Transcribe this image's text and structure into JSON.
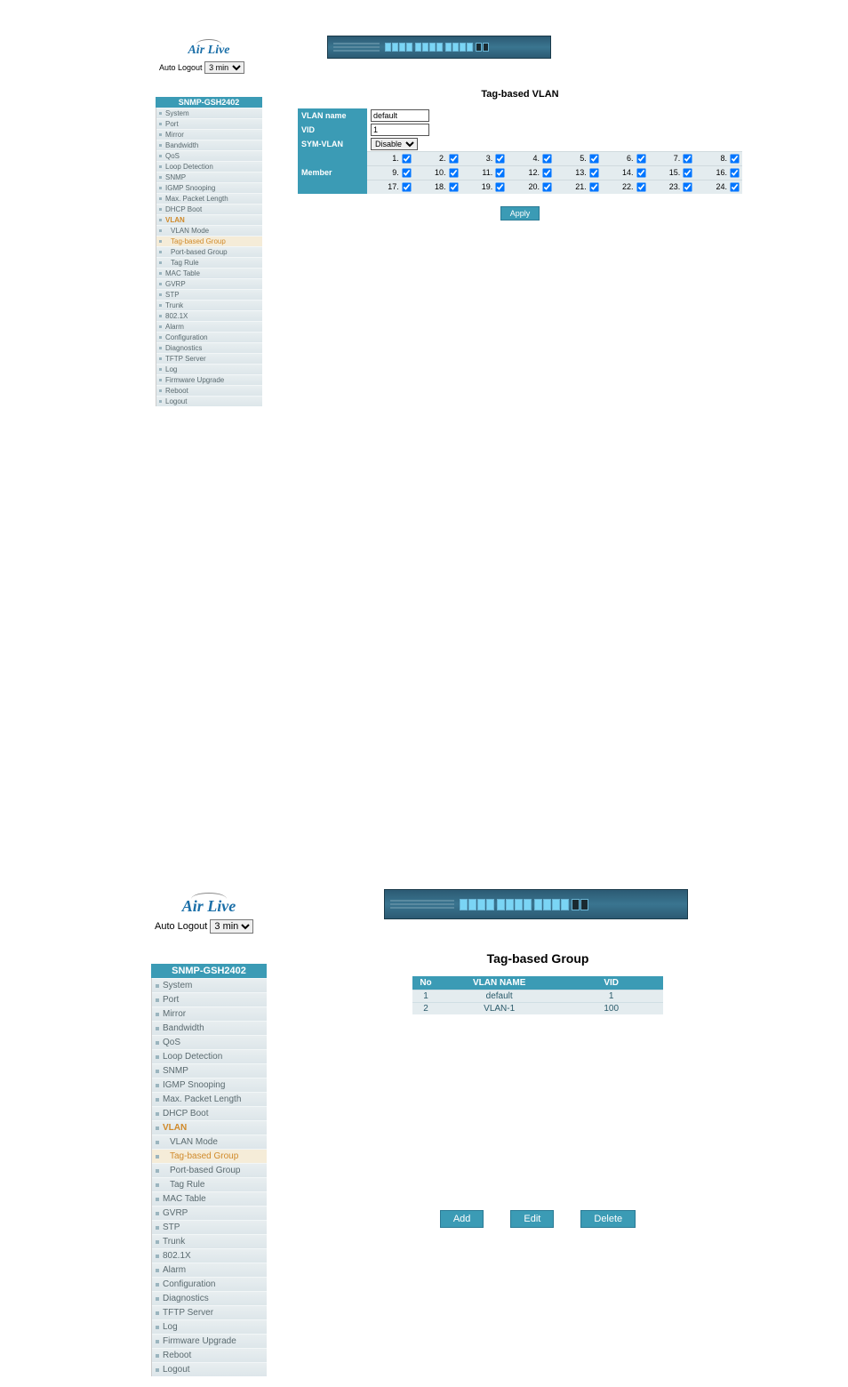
{
  "logo": "Air Live",
  "auto_logout": {
    "label": "Auto Logout",
    "value": "3 min"
  },
  "model": "SNMP-GSH2402",
  "nav": [
    "System",
    "Port",
    "Mirror",
    "Bandwidth",
    "QoS",
    "Loop Detection",
    "SNMP",
    "IGMP Snooping",
    "Max. Packet Length",
    "DHCP Boot"
  ],
  "vlan_section": "VLAN",
  "vlan_sub": [
    "VLAN Mode",
    "Tag-based Group",
    "Port-based Group",
    "Tag Rule"
  ],
  "nav2": [
    "MAC Table",
    "GVRP",
    "STP",
    "Trunk",
    "802.1X",
    "Alarm",
    "Configuration",
    "Diagnostics",
    "TFTP Server",
    "Log",
    "Firmware Upgrade",
    "Reboot",
    "Logout"
  ],
  "screen1": {
    "title": "Tag-based VLAN",
    "fields": {
      "vlan_name": {
        "label": "VLAN name",
        "value": "default"
      },
      "vid": {
        "label": "VID",
        "value": "1"
      },
      "sym_vlan": {
        "label": "SYM-VLAN",
        "value": "Disable"
      },
      "member": {
        "label": "Member"
      }
    },
    "member_ports": [
      1,
      2,
      3,
      4,
      5,
      6,
      7,
      8,
      9,
      10,
      11,
      12,
      13,
      14,
      15,
      16,
      17,
      18,
      19,
      20,
      21,
      22,
      23,
      24
    ],
    "apply": "Apply"
  },
  "screen2": {
    "title": "Tag-based Group",
    "columns": [
      "No",
      "VLAN NAME",
      "VID"
    ],
    "rows": [
      {
        "no": "1",
        "name": "default",
        "vid": "1"
      },
      {
        "no": "2",
        "name": "VLAN-1",
        "vid": "100"
      }
    ],
    "buttons": {
      "add": "Add",
      "edit": "Edit",
      "delete": "Delete"
    }
  }
}
